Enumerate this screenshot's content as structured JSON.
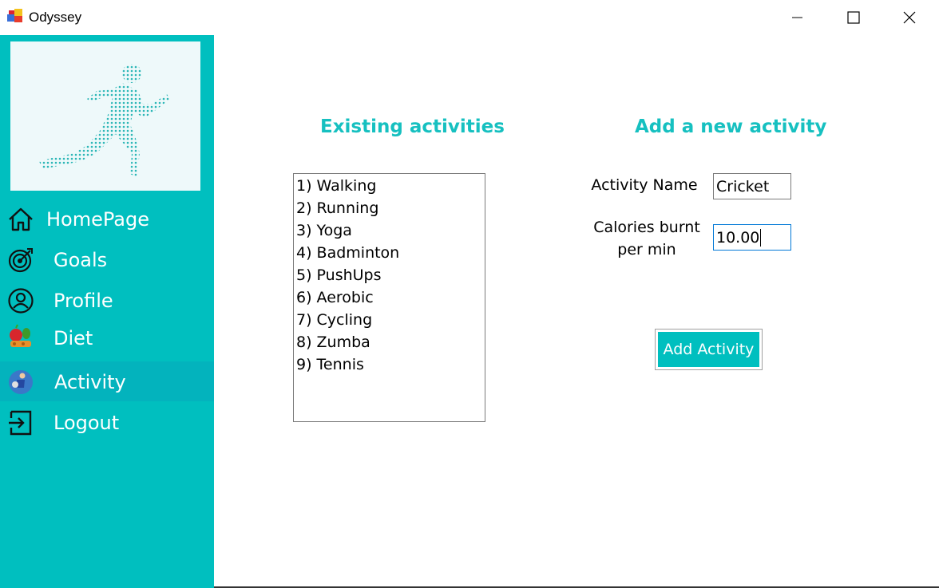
{
  "window": {
    "title": "Odyssey"
  },
  "sidebar": {
    "items": [
      {
        "label": "HomePage",
        "icon": "home-icon"
      },
      {
        "label": "Goals",
        "icon": "target-icon"
      },
      {
        "label": "Profile",
        "icon": "user-icon"
      },
      {
        "label": "Diet",
        "icon": "food-icon"
      },
      {
        "label": "Activity",
        "icon": "activity-icon",
        "active": true
      },
      {
        "label": "Logout",
        "icon": "logout-icon"
      }
    ]
  },
  "existing": {
    "heading": "Existing activities",
    "items": [
      "1) Walking",
      "2) Running",
      "3) Yoga",
      "4) Badminton",
      "5) PushUps",
      "6) Aerobic",
      "7) Cycling",
      "8) Zumba",
      "9) Tennis"
    ]
  },
  "add": {
    "heading": "Add a new activity",
    "name_label": "Activity Name",
    "name_value": "Cricket",
    "calories_label_1": "Calories burnt",
    "calories_label_2": "per min",
    "calories_value": "10.00",
    "button_label": "Add Activity"
  },
  "colors": {
    "accent": "#00bfbf",
    "heading": "#16c0c0",
    "active_nav": "#03b3bd"
  }
}
